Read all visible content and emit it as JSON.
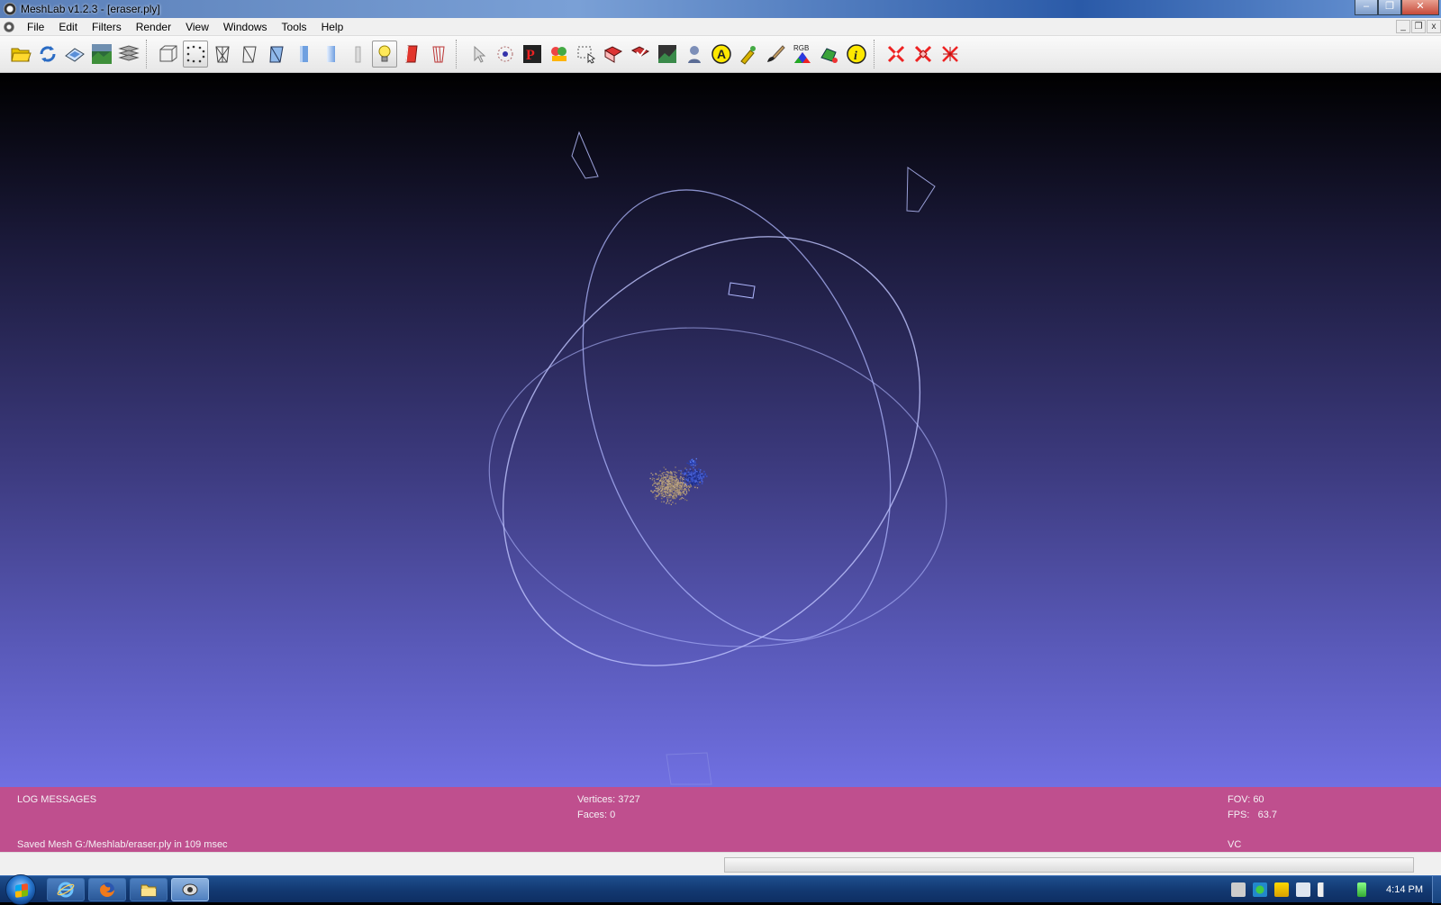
{
  "window": {
    "title": "MeshLab v1.2.3 - [eraser.ply]",
    "minimize_glyph": "–",
    "maximize_glyph": "❐",
    "close_glyph": "✕"
  },
  "mdi": {
    "minimize_glyph": "_",
    "restore_glyph": "❐",
    "close_glyph": "x"
  },
  "menu": [
    "File",
    "Edit",
    "Filters",
    "Render",
    "View",
    "Windows",
    "Tools",
    "Help"
  ],
  "toolbar": {
    "rgb_label": "RGB",
    "icons": [
      "open-icon",
      "reload-icon",
      "save-snapshot-icon",
      "background-image-icon",
      "layers-icon",
      "bounding-box-icon",
      "points-icon",
      "wireframe-icon",
      "hidden-lines-icon",
      "flat-lines-icon",
      "flat-icon",
      "smooth-icon",
      "texture-icon",
      "light-icon",
      "backface-icon",
      "double-side-icon",
      "select-pointer-icon",
      "manipulate-icon",
      "pick-points-icon",
      "paint-icon",
      "select-vertices-icon",
      "select-faces-icon",
      "select-connected-icon",
      "raster-icon",
      "align-icon",
      "annotate-icon",
      "measure-icon",
      "brush-icon",
      "rgb-icon",
      "color-spaces-icon",
      "info-icon",
      "delete-vertices-icon",
      "delete-faces-icon",
      "delete-selected-icon"
    ]
  },
  "info": {
    "log_title": "LOG MESSAGES",
    "log_message": "Saved Mesh G:/Meshlab/eraser.ply in 109 msec",
    "vertices": "Vertices: 3727",
    "faces": "Faces: 0",
    "fov": "FOV: 60",
    "fps": "FPS:   63.7",
    "mode": "VC"
  },
  "taskbar": {
    "clock": "4:14 PM",
    "apps": [
      "internet-explorer-icon",
      "firefox-icon",
      "folder-icon",
      "meshlab-icon"
    ]
  },
  "colors": {
    "info_panel": "#bf4f8e",
    "viewport_top": "#000000",
    "viewport_bottom": "#7070e2",
    "trackball": "#b0b8ff"
  }
}
